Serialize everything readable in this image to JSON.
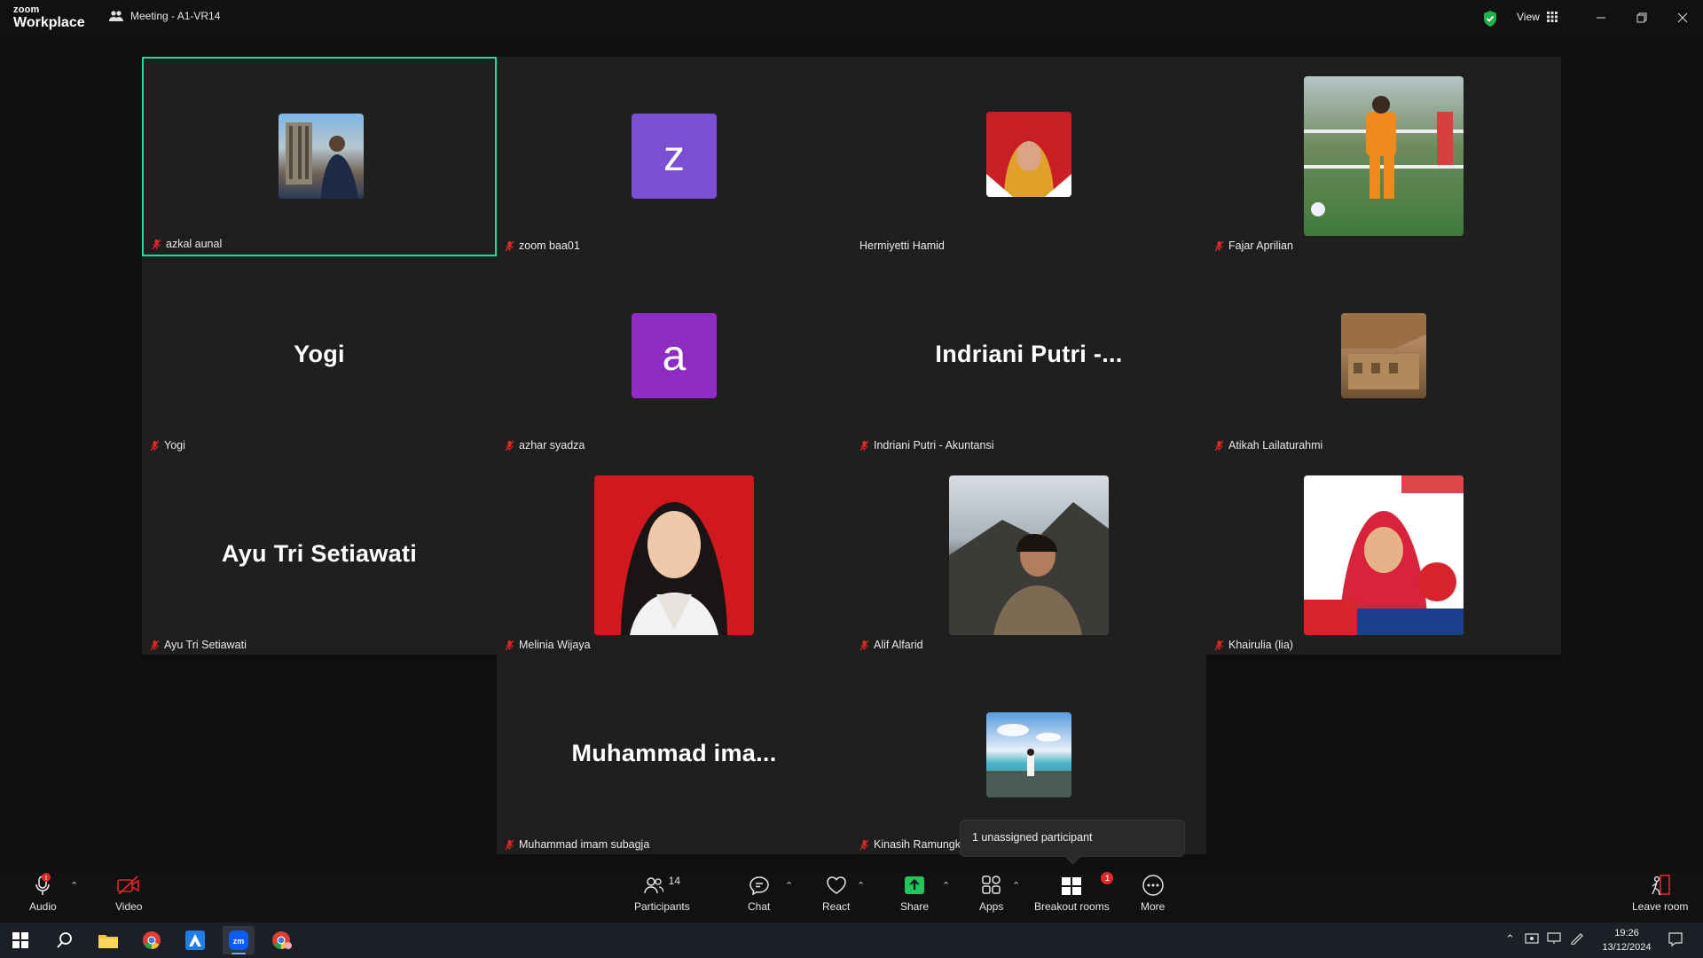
{
  "app": {
    "logo_top": "zoom",
    "logo_bottom": "Workplace",
    "meeting_title": "Meeting - A1-VR14",
    "view_label": "View"
  },
  "colors": {
    "active_border": "#23d9a0",
    "mic_muted": "#e02828",
    "share_green": "#24c45c",
    "badge_red": "#e02828",
    "avatar_z": "#7b4fd1",
    "avatar_a": "#8f2cc4"
  },
  "participants": [
    {
      "name": "azkal aunal",
      "display": "photo",
      "photo": "building-photo",
      "active": true,
      "muted": true
    },
    {
      "name": "zoom baa01",
      "display": "letter",
      "letter": "z",
      "muted": true
    },
    {
      "name": "Hermiyetti Hamid",
      "display": "photo",
      "photo": "hijab-woman-photo",
      "muted": false
    },
    {
      "name": "Fajar Aprilian",
      "display": "photo",
      "photo": "soccer-photo",
      "muted": true
    },
    {
      "name": "Yogi",
      "display": "text",
      "big_name": "Yogi",
      "muted": true
    },
    {
      "name": "azhar syadza",
      "display": "letter",
      "letter": "a",
      "muted": true
    },
    {
      "name": "Indriani Putri - Akuntansi",
      "display": "text",
      "big_name": "Indriani Putri -...",
      "muted": true
    },
    {
      "name": "Atikah Lailaturahmi",
      "display": "photo",
      "photo": "architecture-photo",
      "muted": true
    },
    {
      "name": "Ayu Tri Setiawati",
      "display": "text",
      "big_name": "Ayu Tri Setiawati",
      "muted": true
    },
    {
      "name": "Melinia Wijaya",
      "display": "photo",
      "photo": "portrait-red-bg-photo",
      "muted": true
    },
    {
      "name": "Alif Alfarid",
      "display": "photo",
      "photo": "mountain-man-photo",
      "muted": true
    },
    {
      "name": "Khairulia (lia)",
      "display": "photo",
      "photo": "hijab-banner-photo",
      "muted": true
    },
    {
      "name": "Muhammad imam subagja",
      "display": "text",
      "big_name": "Muhammad  ima...",
      "muted": true
    },
    {
      "name": "Kinasih Ramungk",
      "display": "photo",
      "photo": "beach-photo",
      "muted": true
    }
  ],
  "tooltip": "1 unassigned participant",
  "toolbar": {
    "audio": "Audio",
    "video": "Video",
    "participants": "Participants",
    "participants_count": "14",
    "chat": "Chat",
    "react": "React",
    "share": "Share",
    "apps": "Apps",
    "breakout": "Breakout rooms",
    "breakout_badge": "1",
    "more": "More",
    "leave": "Leave room"
  },
  "taskbar": {
    "time": "19:26",
    "date": "13/12/2024"
  }
}
